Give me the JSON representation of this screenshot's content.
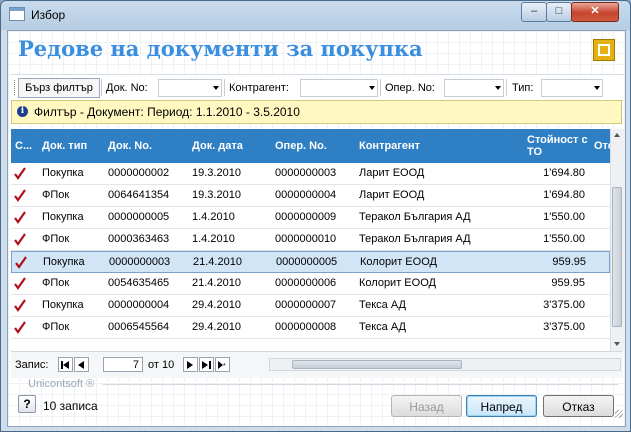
{
  "window": {
    "title": "Избор"
  },
  "heading": "Редове на документи за покупка",
  "filterbar": {
    "quick_filter_label": "Бърз филтър",
    "fields": [
      {
        "label": "Док. No:",
        "value": ""
      },
      {
        "label": "Контрагент:",
        "value": ""
      },
      {
        "label": "Опер. No:",
        "value": ""
      },
      {
        "label": "Тип:",
        "value": ""
      }
    ]
  },
  "info": {
    "text": "Филтър - Документ: Период: 1.1.2010 - 3.5.2010"
  },
  "grid": {
    "columns": [
      "С...",
      "Док. тип",
      "Док. No.",
      "Док. дата",
      "Опер. No.",
      "Контрагент",
      "Стойност с ТО",
      "Отс"
    ],
    "selected_row": 4,
    "rows": [
      {
        "checked": true,
        "type": "Покупка",
        "doc_no": "0000000002",
        "date": "19.3.2010",
        "op_no": "0000000003",
        "partner": "Ларит ЕООД",
        "value": "1'694.80"
      },
      {
        "checked": true,
        "type": "ФПок",
        "doc_no": "0064641354",
        "date": "19.3.2010",
        "op_no": "0000000004",
        "partner": "Ларит ЕООД",
        "value": "1'694.80"
      },
      {
        "checked": true,
        "type": "Покупка",
        "doc_no": "0000000005",
        "date": "1.4.2010",
        "op_no": "0000000009",
        "partner": "Теракол България АД",
        "value": "1'550.00"
      },
      {
        "checked": true,
        "type": "ФПок",
        "doc_no": "0000363463",
        "date": "1.4.2010",
        "op_no": "0000000010",
        "partner": "Теракол България АД",
        "value": "1'550.00"
      },
      {
        "checked": true,
        "type": "Покупка",
        "doc_no": "0000000003",
        "date": "21.4.2010",
        "op_no": "0000000005",
        "partner": "Колорит ЕООД",
        "value": "959.95"
      },
      {
        "checked": true,
        "type": "ФПок",
        "doc_no": "0054635465",
        "date": "21.4.2010",
        "op_no": "0000000006",
        "partner": "Колорит ЕООД",
        "value": "959.95"
      },
      {
        "checked": true,
        "type": "Покупка",
        "doc_no": "0000000004",
        "date": "29.4.2010",
        "op_no": "0000000007",
        "partner": "Текса АД",
        "value": "3'375.00"
      },
      {
        "checked": true,
        "type": "ФПок",
        "doc_no": "0006545564",
        "date": "29.4.2010",
        "op_no": "0000000008",
        "partner": "Текса АД",
        "value": "3'375.00"
      }
    ]
  },
  "navigator": {
    "record_label": "Запис:",
    "current": "7",
    "of_label": "от 10"
  },
  "footer": {
    "brand": "Unicontsoft ®",
    "record_count": "10 записа",
    "back_label": "Назад",
    "next_label": "Напред",
    "cancel_label": "Отказ"
  },
  "colors": {
    "accent": "#2f7fc5",
    "heading": "#3a8ee0",
    "check": "#b0101a",
    "info_bg": "#fff8c0"
  }
}
